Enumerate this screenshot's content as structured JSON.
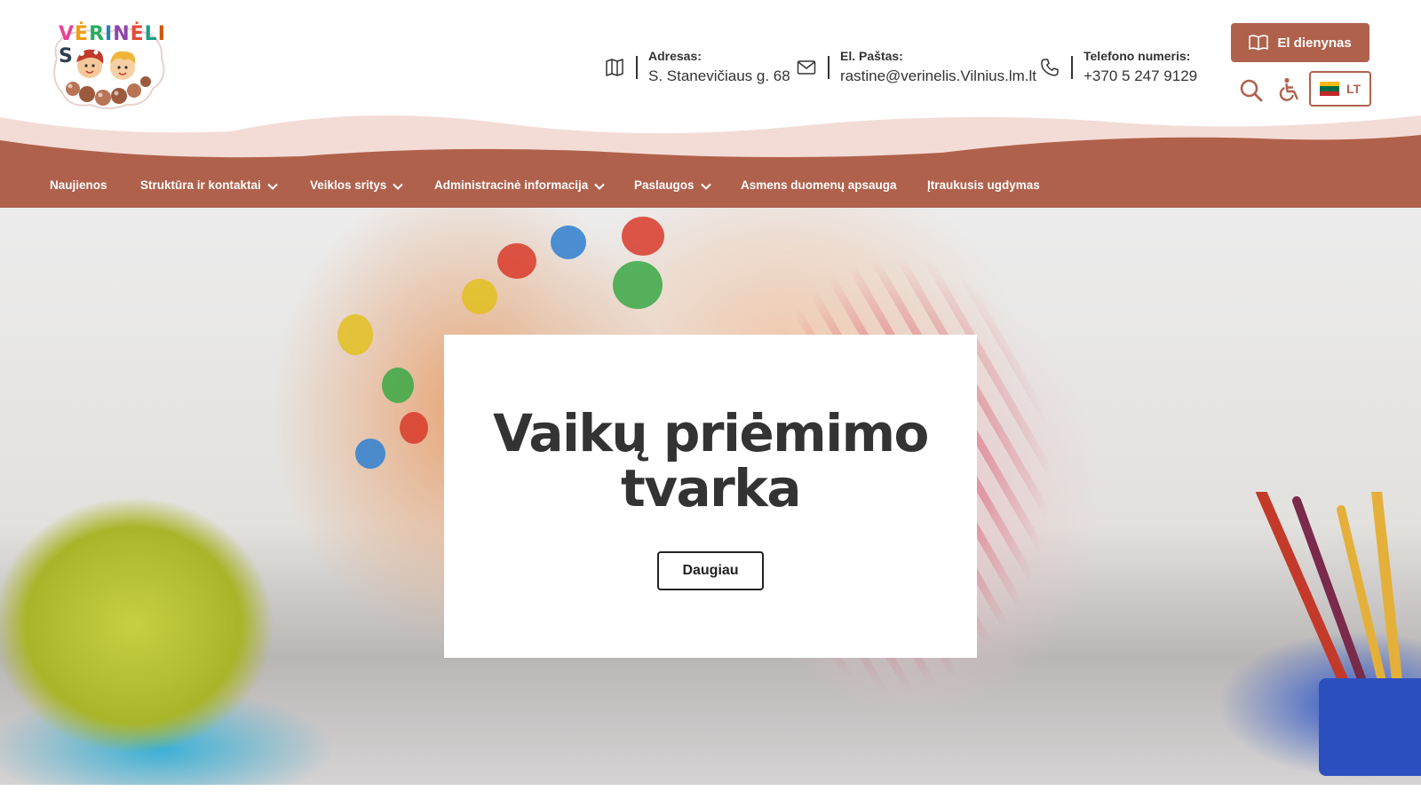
{
  "brand": {
    "logo_text": "VĖRINĖLIS",
    "accent_color": "#b0614c",
    "wave_light": "#f3dcd6"
  },
  "contacts": {
    "address": {
      "label": "Adresas:",
      "value": "S. Stanevičiaus g. 68",
      "icon": "map-icon"
    },
    "email": {
      "label": "El. Paštas:",
      "value": "rastine@verinelis.Vilnius.lm.lt",
      "icon": "envelope-icon"
    },
    "phone": {
      "label": "Telefono numeris:",
      "value": "+370 5 247 9129",
      "icon": "phone-icon"
    }
  },
  "header_tools": {
    "diary_button": "El dienynas",
    "language": "LT",
    "search_icon": "search-icon",
    "accessibility_icon": "wheelchair-icon"
  },
  "nav": {
    "items": [
      {
        "label": "Naujienos",
        "dropdown": false
      },
      {
        "label": "Struktūra ir kontaktai",
        "dropdown": true
      },
      {
        "label": "Veiklos sritys",
        "dropdown": true
      },
      {
        "label": "Administracinė informacija",
        "dropdown": true
      },
      {
        "label": "Paslaugos",
        "dropdown": true
      },
      {
        "label": "Asmens duomenų apsauga",
        "dropdown": false
      },
      {
        "label": "Įtraukusis ugdymas",
        "dropdown": false
      }
    ],
    "social_icon": "facebook-icon"
  },
  "hero": {
    "title": "Vaikų priėmimo tvarka",
    "button": "Daugiau"
  }
}
